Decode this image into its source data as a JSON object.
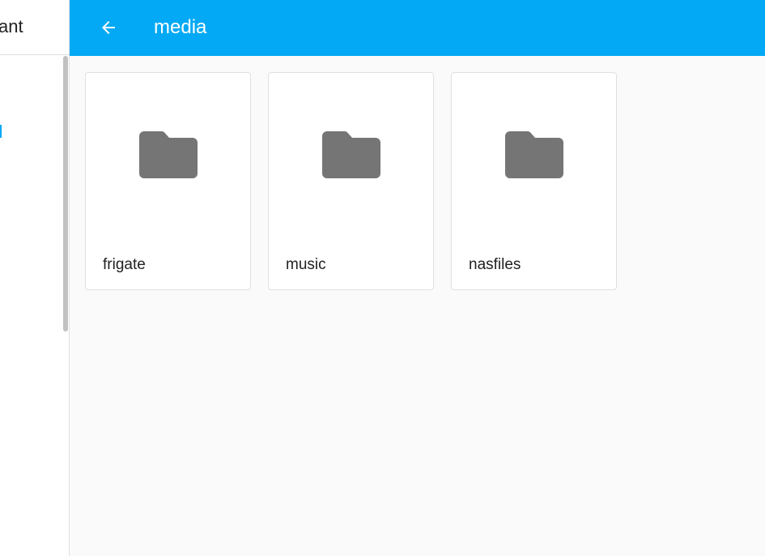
{
  "sidebar": {
    "title": "ant"
  },
  "header": {
    "title": "media"
  },
  "folders": [
    {
      "label": "frigate"
    },
    {
      "label": "music"
    },
    {
      "label": "nasfiles"
    }
  ],
  "colors": {
    "accent": "#03a9f4",
    "folder_icon": "#757575"
  }
}
